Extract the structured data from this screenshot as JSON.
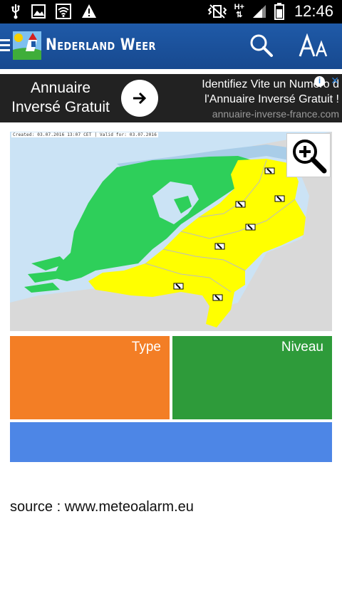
{
  "status_bar": {
    "time": "12:46",
    "network_label": "H+"
  },
  "app_bar": {
    "title": "Nederland Weer"
  },
  "ad": {
    "left_line1": "Annuaire",
    "left_line2": "Inversé Gratuit",
    "right_line1": "Identifiez Vite un Numéro d",
    "right_line2": "l'Annuaire Inversé Gratuit !",
    "url": "annuaire-inverse-france.com"
  },
  "map": {
    "caption": "Created: 03.07.2016 13:07 CET | Valid for: 03.07.2016",
    "colors": {
      "sea": "#cbe3f5",
      "green": "#2ecf5a",
      "yellow": "#ffff00",
      "land": "#d9d9d9"
    }
  },
  "tiles": {
    "type_label": "Type",
    "niveau_label": "Niveau",
    "description": ""
  },
  "footer": {
    "source": "source : www.meteoalarm.eu"
  }
}
